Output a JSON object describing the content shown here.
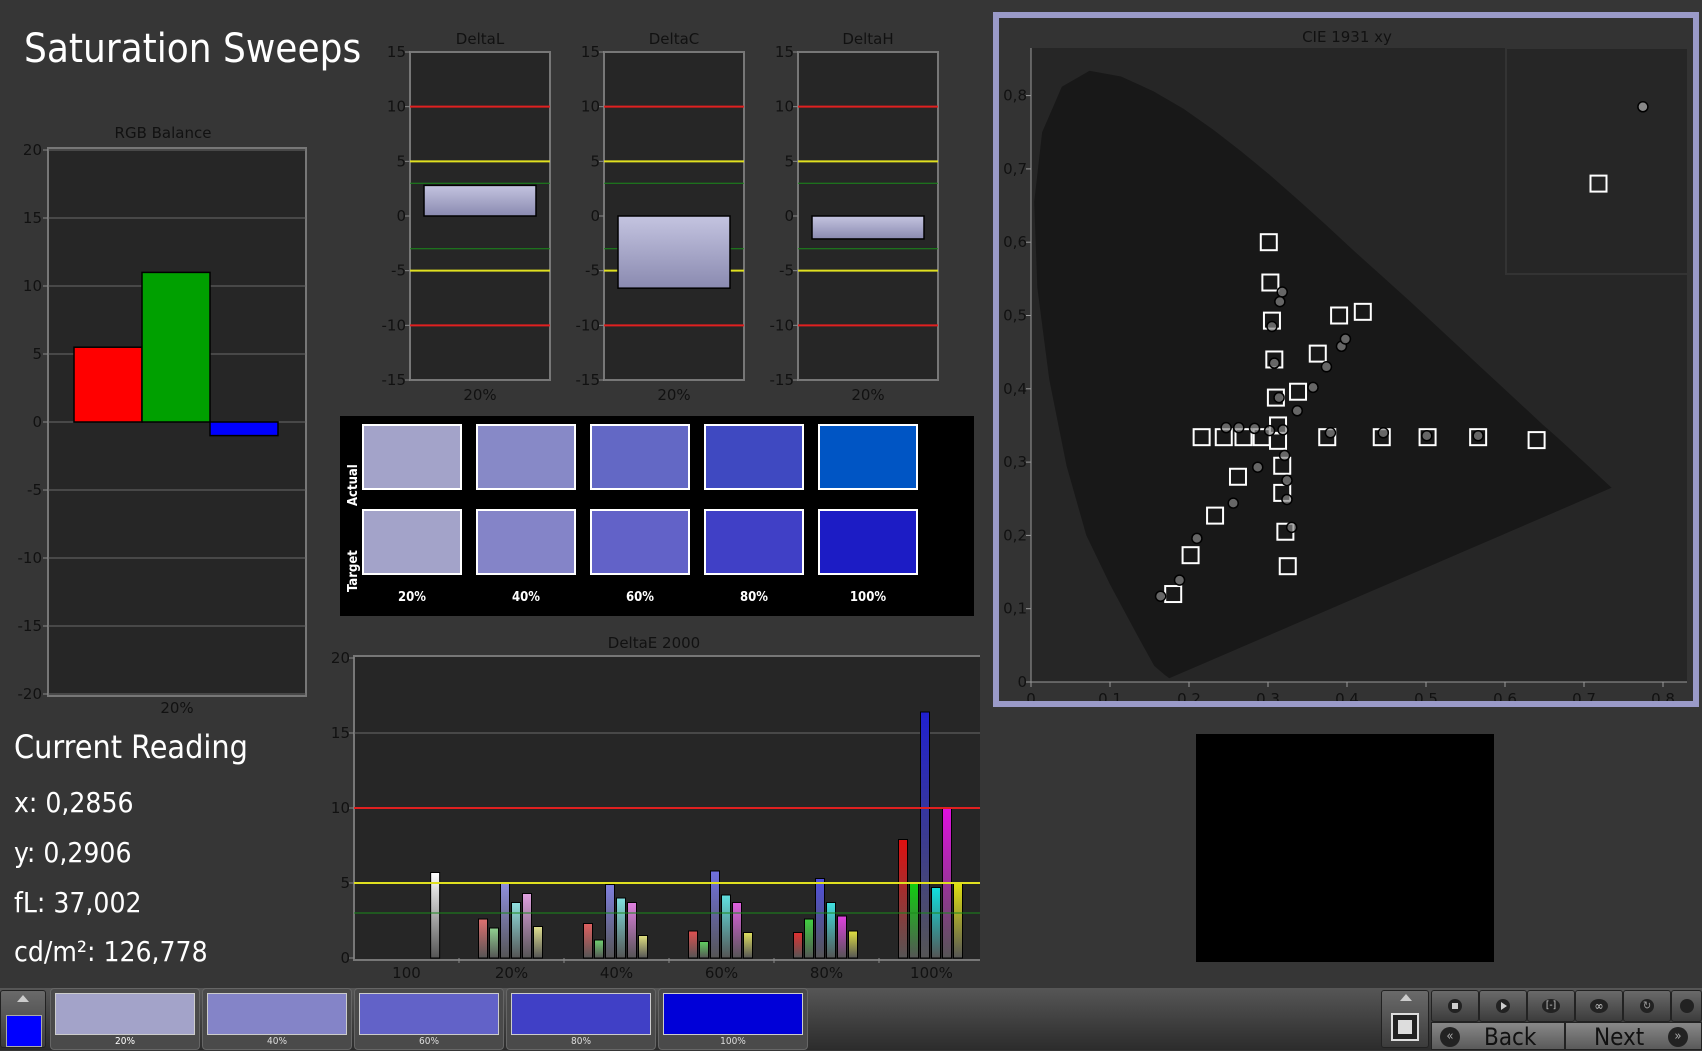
{
  "title": "Saturation Sweeps",
  "rgb_balance": {
    "title": "RGB Balance",
    "y_ticks": [
      "20",
      "15",
      "10",
      "5",
      "0",
      "-5",
      "-10",
      "-15",
      "-20"
    ],
    "x_label": "20%",
    "bars": [
      {
        "name": "Red",
        "value": 5.5,
        "color": "#ff0000"
      },
      {
        "name": "Green",
        "value": 11,
        "color": "#00a000"
      },
      {
        "name": "Blue",
        "value": -1,
        "color": "#0000ff"
      }
    ]
  },
  "delta_charts": [
    {
      "title": "DeltaL",
      "value": 2.8,
      "x_label": "20%"
    },
    {
      "title": "DeltaC",
      "value": -6.6,
      "x_label": "20%"
    },
    {
      "title": "DeltaH",
      "value": -2.1,
      "x_label": "20%"
    }
  ],
  "delta_ticks": [
    "15",
    "10",
    "5",
    "0",
    "-5",
    "-10",
    "-15"
  ],
  "swatches": {
    "row_actual": "Actual",
    "row_target": "Target",
    "labels": [
      "20%",
      "40%",
      "60%",
      "80%",
      "100%"
    ],
    "actual_colors": [
      "#a3a3c9",
      "#8789c7",
      "#6368c5",
      "#3f49c1",
      "#0055c4"
    ],
    "target_colors": [
      "#a3a3c9",
      "#8484c8",
      "#6262c8",
      "#4040c6",
      "#1c1cc5"
    ]
  },
  "deltae": {
    "title": "DeltaE 2000",
    "y_ticks": [
      "20",
      "15",
      "10",
      "5",
      "0"
    ],
    "x_labels": [
      "100",
      "20%",
      "40%",
      "60%",
      "80%",
      "100%"
    ],
    "groups": [
      {
        "bars": [
          {
            "v": 5.7,
            "c": "#ffffff"
          }
        ]
      },
      {
        "bars": [
          {
            "v": 2.6,
            "c": "#e07070"
          },
          {
            "v": 2.0,
            "c": "#90d090"
          },
          {
            "v": 5.0,
            "c": "#9090e0"
          },
          {
            "v": 3.7,
            "c": "#90e0e0"
          },
          {
            "v": 4.3,
            "c": "#e0a0e0"
          },
          {
            "v": 2.1,
            "c": "#e0e090"
          }
        ]
      },
      {
        "bars": [
          {
            "v": 2.3,
            "c": "#e06060"
          },
          {
            "v": 1.2,
            "c": "#70d070"
          },
          {
            "v": 4.9,
            "c": "#8080e0"
          },
          {
            "v": 4.0,
            "c": "#80e0e0"
          },
          {
            "v": 3.7,
            "c": "#e080e0"
          },
          {
            "v": 1.5,
            "c": "#e0e080"
          }
        ]
      },
      {
        "bars": [
          {
            "v": 1.8,
            "c": "#e05050"
          },
          {
            "v": 1.1,
            "c": "#60d060"
          },
          {
            "v": 5.8,
            "c": "#7070e0"
          },
          {
            "v": 4.2,
            "c": "#60e0e0"
          },
          {
            "v": 3.7,
            "c": "#e060e0"
          },
          {
            "v": 1.7,
            "c": "#e0e060"
          }
        ]
      },
      {
        "bars": [
          {
            "v": 1.7,
            "c": "#e03030"
          },
          {
            "v": 2.6,
            "c": "#40d040"
          },
          {
            "v": 5.3,
            "c": "#5050e0"
          },
          {
            "v": 3.7,
            "c": "#40e0e0"
          },
          {
            "v": 2.8,
            "c": "#e040e0"
          },
          {
            "v": 1.8,
            "c": "#e0e040"
          }
        ]
      },
      {
        "bars": [
          {
            "v": 7.9,
            "c": "#e01010"
          },
          {
            "v": 5.0,
            "c": "#10d010"
          },
          {
            "v": 16.4,
            "c": "#2020d0"
          },
          {
            "v": 4.7,
            "c": "#10e0e0"
          },
          {
            "v": 10.0,
            "c": "#e010e0"
          },
          {
            "v": 5.0,
            "c": "#e0e010"
          }
        ]
      }
    ]
  },
  "cie": {
    "title": "CIE 1931 xy",
    "x_ticks": [
      "0",
      "0,1",
      "0,2",
      "0,3",
      "0,4",
      "0,5",
      "0,6",
      "0,7",
      "0,8"
    ],
    "y_ticks": [
      "0,8",
      "0,7",
      "0,6",
      "0,5",
      "0,4",
      "0,3",
      "0,2",
      "0,1",
      "0"
    ],
    "targets": [
      [
        0.301,
        0.6
      ],
      [
        0.303,
        0.545
      ],
      [
        0.305,
        0.493
      ],
      [
        0.308,
        0.44
      ],
      [
        0.31,
        0.388
      ],
      [
        0.216,
        0.334
      ],
      [
        0.244,
        0.334
      ],
      [
        0.269,
        0.334
      ],
      [
        0.292,
        0.334
      ],
      [
        0.3127,
        0.329
      ],
      [
        0.18,
        0.12
      ],
      [
        0.202,
        0.173
      ],
      [
        0.233,
        0.227
      ],
      [
        0.262,
        0.28
      ],
      [
        0.375,
        0.334
      ],
      [
        0.444,
        0.334
      ],
      [
        0.502,
        0.334
      ],
      [
        0.566,
        0.334
      ],
      [
        0.64,
        0.33
      ],
      [
        0.338,
        0.396
      ],
      [
        0.363,
        0.448
      ],
      [
        0.39,
        0.5
      ],
      [
        0.42,
        0.505
      ],
      [
        0.3127,
        0.35
      ],
      [
        0.318,
        0.258
      ],
      [
        0.322,
        0.205
      ],
      [
        0.325,
        0.158
      ],
      [
        0.318,
        0.295
      ]
    ],
    "measured": [
      [
        0.318,
        0.532
      ],
      [
        0.315,
        0.519
      ],
      [
        0.305,
        0.485
      ],
      [
        0.308,
        0.435
      ],
      [
        0.314,
        0.388
      ],
      [
        0.247,
        0.347
      ],
      [
        0.263,
        0.347
      ],
      [
        0.283,
        0.346
      ],
      [
        0.302,
        0.343
      ],
      [
        0.319,
        0.344
      ],
      [
        0.164,
        0.117
      ],
      [
        0.188,
        0.139
      ],
      [
        0.21,
        0.196
      ],
      [
        0.256,
        0.244
      ],
      [
        0.287,
        0.293
      ],
      [
        0.321,
        0.309
      ],
      [
        0.324,
        0.275
      ],
      [
        0.324,
        0.249
      ],
      [
        0.33,
        0.211
      ],
      [
        0.379,
        0.34
      ],
      [
        0.446,
        0.34
      ],
      [
        0.501,
        0.336
      ],
      [
        0.566,
        0.336
      ],
      [
        0.337,
        0.37
      ],
      [
        0.357,
        0.402
      ],
      [
        0.374,
        0.43
      ],
      [
        0.393,
        0.458
      ],
      [
        0.398,
        0.468
      ]
    ],
    "inset_target": [
      0.33,
      0.32
    ],
    "inset_measured": [
      0.342,
      0.337
    ]
  },
  "current_reading": {
    "heading": "Current Reading",
    "x": "x: 0,2856",
    "y": "y: 0,2906",
    "fl": "fL: 37,002",
    "cdm2": "cd/m²: 126,778"
  },
  "bottom": {
    "tabs": [
      {
        "label": "20%",
        "color": "#a3a3c9"
      },
      {
        "label": "40%",
        "color": "#8484c8"
      },
      {
        "label": "60%",
        "color": "#6262c8"
      },
      {
        "label": "80%",
        "color": "#4040c6"
      },
      {
        "label": "100%",
        "color": "#0000d8"
      }
    ],
    "back_label": "Back",
    "next_label": "Next"
  }
}
